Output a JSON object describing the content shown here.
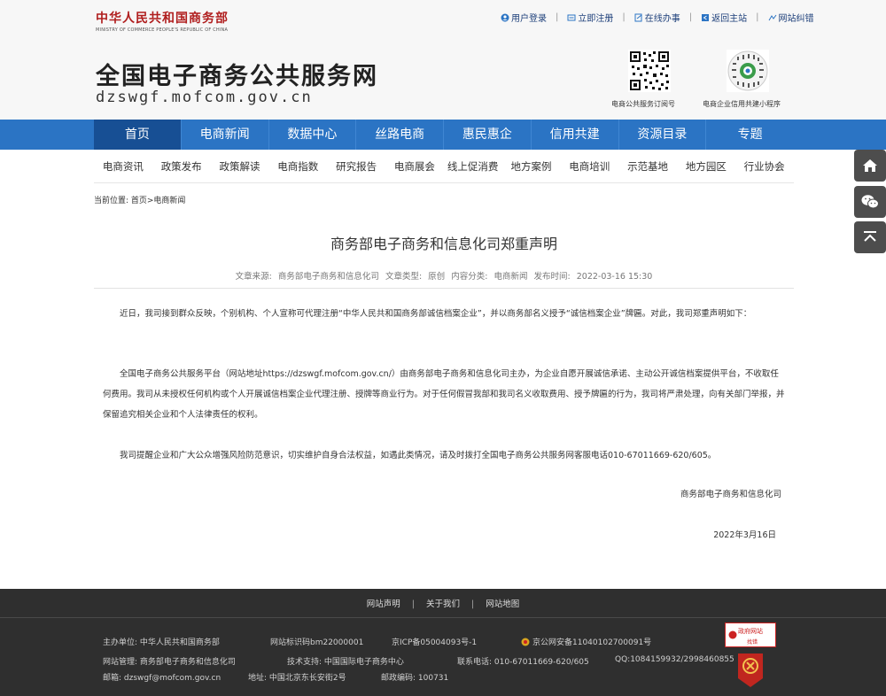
{
  "header": {
    "mofcom_name": "中华人民共和国商务部",
    "mofcom_en": "MINISTRY OF COMMERCE PEOPLE'S REPUBLIC OF CHINA",
    "site_title": "全国电子商务公共服务网",
    "site_url": "dzswgf.mofcom.gov.cn",
    "top_links": [
      {
        "label": "用户登录",
        "icon": "user-icon"
      },
      {
        "label": "立即注册",
        "icon": "register-icon"
      },
      {
        "label": "在线办事",
        "icon": "edit-icon"
      },
      {
        "label": "返回主站",
        "icon": "return-icon"
      },
      {
        "label": "网站纠错",
        "icon": "feedback-icon"
      }
    ],
    "qr_codes": [
      {
        "caption": "电商公共服务订阅号"
      },
      {
        "caption": "电商企业信用共建小程序"
      }
    ]
  },
  "main_nav": {
    "active_index": 0,
    "items": [
      "首页",
      "电商新闻",
      "数据中心",
      "丝路电商",
      "惠民惠企",
      "信用共建",
      "资源目录",
      "专题"
    ]
  },
  "sub_nav": {
    "items": [
      "电商资讯",
      "政策发布",
      "政策解读",
      "电商指数",
      "研究报告",
      "电商展会",
      "线上促消费",
      "地方案例",
      "电商培训",
      "示范基地",
      "地方园区",
      "行业协会"
    ]
  },
  "breadcrumb": "当前位置: 首页>电商新闻",
  "article": {
    "title": "商务部电子商务和信息化司郑重声明",
    "meta": {
      "source_label": "文章来源:",
      "source": "商务部电子商务和信息化司",
      "type_label": "文章类型:",
      "type": "原创",
      "category_label": "内容分类:",
      "category": "电商新闻",
      "time_label": "发布时间:",
      "time": "2022-03-16 15:30"
    },
    "paragraphs": [
      "近日，我司接到群众反映，个别机构、个人宣称可代理注册“中华人民共和国商务部诚信档案企业”，并以商务部名义授予“诚信档案企业”牌匾。对此，我司郑重声明如下：",
      "全国电子商务公共服务平台（网站地址https://dzswgf.mofcom.gov.cn/）由商务部电子商务和信息化司主办，为企业自愿开展诚信承诺、主动公开诚信档案提供平台，不收取任何费用。我司从未授权任何机构或个人开展诚信档案企业代理注册、授牌等商业行为。对于任何假冒我部和我司名义收取费用、授予牌匾的行为，我司将严肃处理，向有关部门举报，并保留追究相关企业和个人法律责任的权利。",
      "我司提醒企业和广大公众增强风险防范意识，切实维护自身合法权益，如遇此类情况，请及时拨打全国电子商务公共服务网客服电话010-67011669-620/605。"
    ],
    "signature": "商务部电子商务和信息化司",
    "date": "2022年3月16日"
  },
  "side_buttons": [
    {
      "icon": "home-icon"
    },
    {
      "icon": "wechat-icon"
    },
    {
      "icon": "back-to-top-icon"
    }
  ],
  "footer": {
    "links": [
      "网站声明",
      "关于我们",
      "网站地图"
    ],
    "host": "主办单位: 中华人民共和国商务部",
    "site_id": "网站标识码bm22000001",
    "icp": "京ICP备05004093号-1",
    "police": "京公网安备11040102700091号",
    "manager": "网站管理: 商务部电子商务和信息化司",
    "tech": "技术支持: 中国国际电子商务中心",
    "phone": "联系电话: 010-67011669-620/605",
    "qq": "QQ:1084159932/2998460855",
    "email": "邮箱: dzswgf@mofcom.gov.cn",
    "address": "地址: 中国北京东长安街2号",
    "postcode": "邮政编码: 100731",
    "gov_badge": "政府网站",
    "gov_badge_sub": "找错"
  },
  "colors": {
    "nav_blue": "#2b74c4",
    "nav_active": "#174f94",
    "brand_red": "#b01e1e",
    "footer_bg": "#2f2f2f"
  }
}
